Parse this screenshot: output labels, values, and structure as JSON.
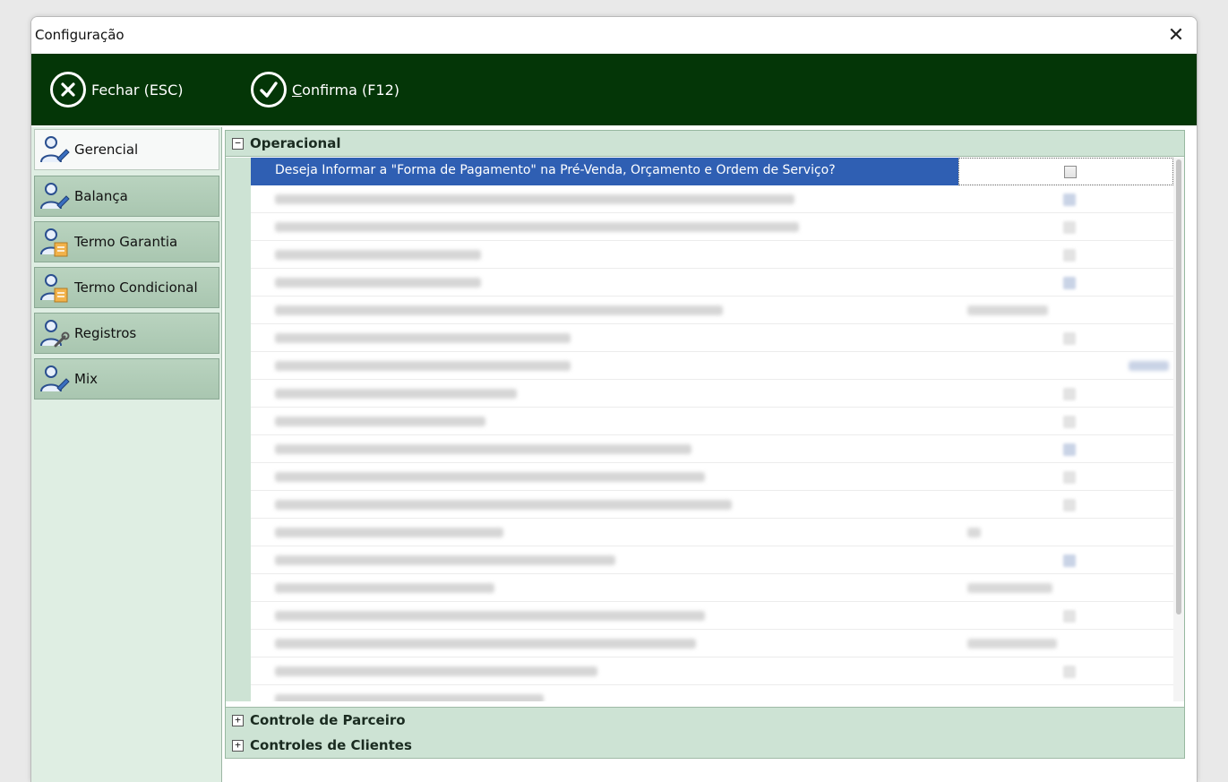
{
  "window": {
    "title": "Configuração",
    "close_glyph": "✕"
  },
  "toolbar": {
    "close_label": "Fechar (ESC)",
    "confirm_label_first": "C",
    "confirm_label_rest": "onfirma (F12)",
    "close_icon": "x-circle-icon",
    "confirm_icon": "check-circle-icon",
    "background": "#043607"
  },
  "sidebar": {
    "items": [
      {
        "label": "Gerencial",
        "icon": "user-pen-icon",
        "active": true
      },
      {
        "label": "Balança",
        "icon": "user-pen-icon",
        "active": false
      },
      {
        "label": "Termo Garantia",
        "icon": "user-document-icon",
        "active": false
      },
      {
        "label": "Termo Condicional",
        "icon": "user-document-icon",
        "active": false
      },
      {
        "label": "Registros",
        "icon": "user-wrench-icon",
        "active": false
      },
      {
        "label": "Mix",
        "icon": "user-pen-icon",
        "active": false
      }
    ]
  },
  "groups": [
    {
      "label": "Operacional",
      "expanded": true,
      "expander": "−"
    },
    {
      "label": "Controle de Parceiro",
      "expanded": false,
      "expander": "+"
    },
    {
      "label": "Controles de Clientes",
      "expanded": false,
      "expander": "+"
    }
  ],
  "operacional": {
    "selected_row": {
      "label": "Deseja Informar a \"Forma de Pagamento\" na Pré-Venda, Orçamento e Ordem de Serviço?",
      "checked": false
    }
  },
  "colors": {
    "selection": "#2f5fb3",
    "group_header": "#cde3d4"
  }
}
